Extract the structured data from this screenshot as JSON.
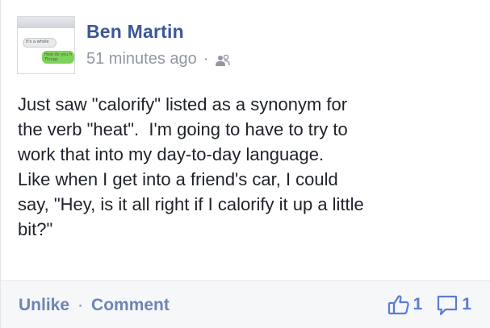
{
  "post": {
    "author": "Ben Martin",
    "timestamp": "51 minutes ago",
    "separator": "·",
    "privacy_icon": "friends-icon",
    "text": "Just saw \"calorify\" listed as a synonym for\nthe verb \"heat\".  I'm going to have to try to\nwork that into my day-to-day language.\nLike when I get into a friend's car, I could\nsay, \"Hey, is it all right if I calorify it up a little\nbit?\"",
    "avatar": {
      "bubble_a_text": "It's a whole",
      "bubble_b_text": "How do you h\nThings"
    }
  },
  "footer": {
    "unlike_label": "Unlike",
    "separator": "·",
    "comment_label": "Comment",
    "like_count": "1",
    "comment_count": "1"
  },
  "colors": {
    "link": "#3b5998",
    "meta": "#9197a3",
    "action": "#6d84b4",
    "count": "#5b7bd5",
    "footer_bg": "#f6f7f9"
  }
}
